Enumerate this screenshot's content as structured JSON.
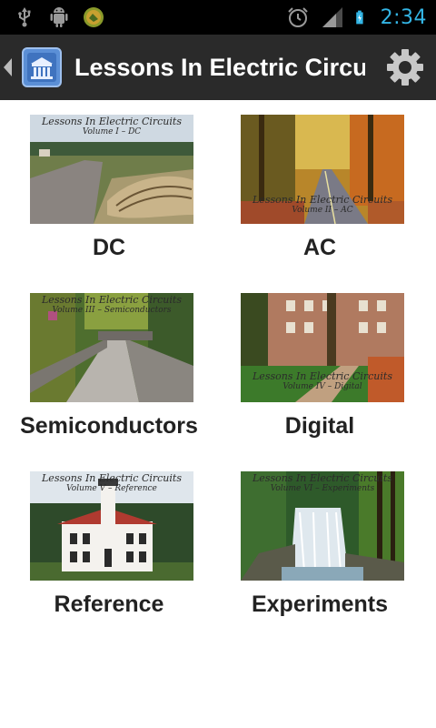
{
  "status_bar": {
    "left_icons": [
      "usb-icon",
      "android-debug-icon",
      "app-notification-icon"
    ],
    "right_icons": [
      "alarm-icon",
      "signal-icon",
      "battery-charging-icon"
    ],
    "time": "2:34"
  },
  "action_bar": {
    "title": "Lessons In Electric Circu.",
    "up_icon": "back-caret-icon",
    "logo_icon": "app-logo-icon",
    "settings_icon": "gear-icon"
  },
  "volumes": [
    {
      "label": "DC",
      "cover_title": "Lessons In Electric Circuits",
      "cover_sub": "Volume I – DC"
    },
    {
      "label": "AC",
      "cover_title": "Lessons In Electric Circuits",
      "cover_sub": "Volume II – AC"
    },
    {
      "label": "Semiconductors",
      "cover_title": "Lessons In Electric Circuits",
      "cover_sub": "Volume III – Semiconductors"
    },
    {
      "label": "Digital",
      "cover_title": "Lessons In Electric Circuits",
      "cover_sub": "Volume IV – Digital"
    },
    {
      "label": "Reference",
      "cover_title": "Lessons In Electric Circuits",
      "cover_sub": "Volume V – Reference"
    },
    {
      "label": "Experiments",
      "cover_title": "Lessons In Electric Circuits",
      "cover_sub": "Volume VI – Experiments"
    }
  ],
  "colors": {
    "status_bar_bg": "#000000",
    "status_accent": "#33b5e5",
    "action_bar_bg": "#2a2a2a",
    "page_bg": "#ffffff",
    "label_text": "#222222"
  }
}
